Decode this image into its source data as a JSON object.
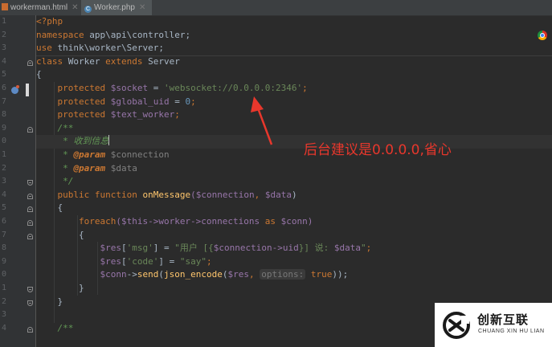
{
  "tabs": [
    {
      "label": "workerman.html",
      "icon": "html-file-icon",
      "active": false
    },
    {
      "label": "Worker.php",
      "icon": "php-class-icon",
      "active": true
    }
  ],
  "line_numbers": [
    "1",
    "2",
    "3",
    "4",
    "5",
    "6",
    "7",
    "8",
    "9",
    "0",
    "1",
    "2",
    "3",
    "4",
    "5",
    "6",
    "7",
    "8",
    "9",
    "0",
    "1",
    "2",
    "3",
    "4"
  ],
  "code": {
    "l1": "<?php",
    "l2_kw": "namespace",
    "l2_rest": " app\\api\\controller;",
    "l3_kw": "use",
    "l3_rest": " think\\worker\\Server;",
    "l4_kw1": "class",
    "l4_name": " Worker ",
    "l4_kw2": "extends",
    "l4_parent": " Server",
    "l5": "{",
    "l6_kw": "protected",
    "l6_var": "$socket",
    "l6_eq": " = ",
    "l6_str": "'websocket://0.0.0.0:2346'",
    "l6_end": ";",
    "l7_kw": "protected",
    "l7_var": "$global_uid",
    "l7_eq": " = ",
    "l7_num": "0",
    "l7_end": ";",
    "l8_kw": "protected",
    "l8_var": "$text_worker",
    "l8_end": ";",
    "l9": "/**",
    "l10": " * 收到信息",
    "l11_tag": "@param",
    "l11_var": " $connection",
    "l12_tag": "@param",
    "l12_var": " $data",
    "l13": " */",
    "l14_kw1": "public",
    "l14_kw2": "function",
    "l14_fn": "onMessage",
    "l14_p1": "($connection",
    "l14_p2": ", ",
    "l14_p3": "$data",
    "l14_p4": ")",
    "l15": "{",
    "l16_kw": "foreach",
    "l16_a": "($this->worker->connections ",
    "l16_as": "as",
    "l16_b": " $conn)",
    "l17": "{",
    "l18_var": "$res",
    "l18_a": "[",
    "l18_key": "'msg'",
    "l18_b": "] = ",
    "l18_str1": "\"用户 [{",
    "l18_var2": "$connection->uid",
    "l18_str2": "}] 说: ",
    "l18_var3": "$data",
    "l18_str3": "\"",
    "l18_end": ";",
    "l19_var": "$res",
    "l19_a": "[",
    "l19_key": "'code'",
    "l19_b": "] = ",
    "l19_str": "\"say\"",
    "l19_end": ";",
    "l20_var": "$conn",
    "l20_a": "->",
    "l20_fn": "send",
    "l20_b": "(",
    "l20_fn2": "json_encode",
    "l20_c": "(",
    "l20_var2": "$res",
    "l20_d": ", ",
    "l20_hint": "options:",
    "l20_true": " true",
    "l20_e": "));",
    "l21": "}",
    "l22": "}",
    "l24": "/**"
  },
  "annotation": {
    "text": "后台建议是0.0.0.0,省心",
    "color": "#e8372c"
  },
  "watermark": {
    "title": "创新互联",
    "subtitle": "CHUANG XIN HU LIAN"
  },
  "colors": {
    "background": "#2b2b2b",
    "keyword": "#cc7832",
    "variable": "#9876aa",
    "string": "#6a8759",
    "number": "#6897bb",
    "function": "#ffc66d",
    "doc_comment": "#629755"
  }
}
